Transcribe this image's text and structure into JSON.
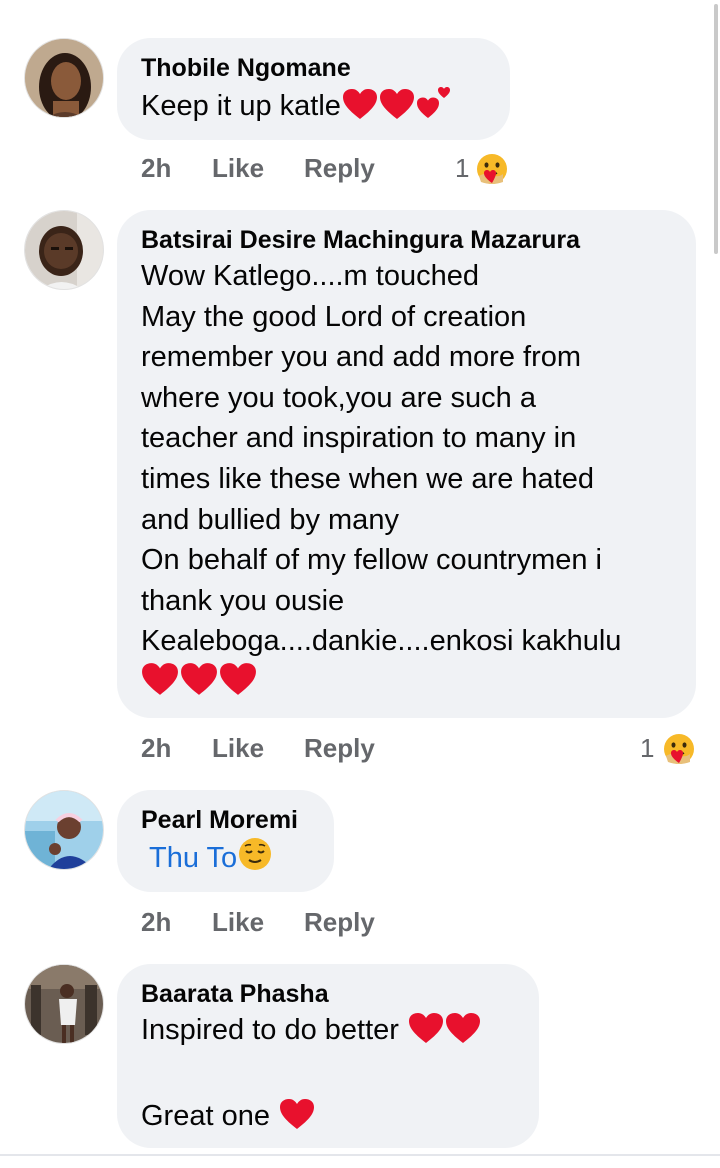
{
  "colors": {
    "bubble": "#f0f2f5",
    "meta_text": "#65676b",
    "heart": "#e8112d",
    "tag_link": "#1a6ed8"
  },
  "comments": [
    {
      "author": "Thobile Ngomane",
      "lines": [
        "Keep it up katle"
      ],
      "trailing_emoji": [
        "heart-icon",
        "heart-icon",
        "hearts-icon"
      ],
      "time": "2h",
      "like": "Like",
      "reply": "Reply",
      "reaction_count": "1",
      "reaction_icon": "care-emoji-icon"
    },
    {
      "author": "Batsirai Desire Machingura Mazarura",
      "lines": [
        "Wow Katlego....m touched",
        "May the good Lord of creation",
        "remember you and add more from",
        "where you took,you are such a",
        "teacher and inspiration to many in",
        "times like these when we are hated",
        "and bullied by many",
        "On behalf of my fellow countrymen i",
        "thank you ousie",
        "Kealeboga....dankie....enkosi kakhulu"
      ],
      "trailing_emoji": [
        "heart-icon",
        "heart-icon",
        "heart-icon"
      ],
      "time": "2h",
      "like": "Like",
      "reply": "Reply",
      "reaction_count": "1",
      "reaction_icon": "care-emoji-icon"
    },
    {
      "author": "Pearl Moremi",
      "lines": [
        "Thu To"
      ],
      "tag_emoji": "relieved-face-icon",
      "time": "2h",
      "like": "Like",
      "reply": "Reply"
    },
    {
      "author": "Baarata Phasha",
      "lines": [
        "Inspired to do better",
        "",
        "Great one"
      ],
      "trailing_emoji": [
        "heart-icon",
        "heart-icon"
      ],
      "time": "",
      "like": "",
      "reply": ""
    }
  ]
}
